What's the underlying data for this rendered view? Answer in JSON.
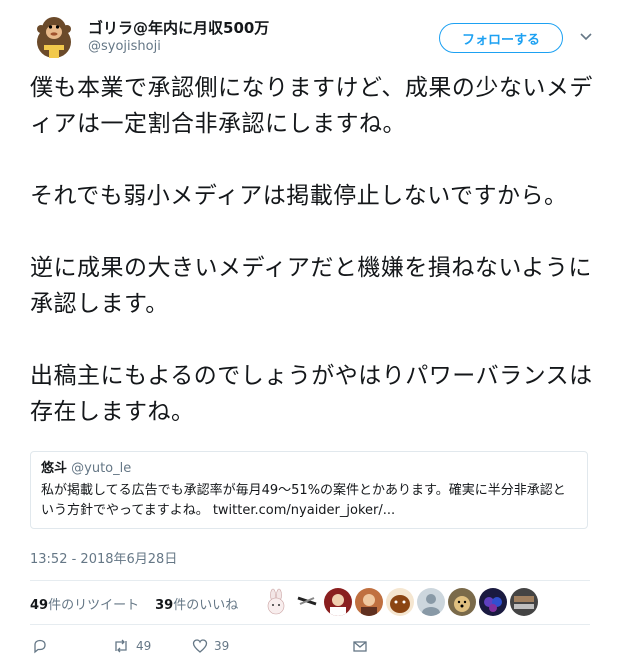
{
  "author": {
    "display_name": "ゴリラ@年内に月収500万",
    "screen_name": "@syojishoji",
    "avatar": "gorilla-avatar"
  },
  "follow_button": {
    "label": "フォローする",
    "color": "#1da1f2"
  },
  "tweet": {
    "paragraphs": [
      "僕も本業で承認側になりますけど、成果の少ないメディアは一定割合非承認にしますね。",
      "それでも弱小メディアは掲載停止しないですから。",
      "逆に成果の大きいメディアだと機嫌を損ねないように承認します。",
      "出稿主にもよるのでしょうがやはりパワーバランスは存在しますね。"
    ]
  },
  "quote": {
    "name": "悠斗",
    "handle": "@yuto_le",
    "text": "私が掲載してる広告でも承認率が毎月49〜51%の案件とかあります。確実に半分非承認という方針でやってますよね。 twitter.com/nyaider_joker/..."
  },
  "timestamp": "13:52 - 2018年6月28日",
  "stats": {
    "retweets_count": "49",
    "retweets_label": "件のリツイート",
    "likes_count": "39",
    "likes_label": "件のいいね"
  },
  "actions": {
    "reply_count": "",
    "retweet_count": "49",
    "like_count": "39"
  },
  "liker_avatars": [
    "rabbit",
    "tool",
    "person-1",
    "person-2",
    "brown-blob",
    "default-user",
    "dog",
    "cat-party",
    "panel"
  ]
}
